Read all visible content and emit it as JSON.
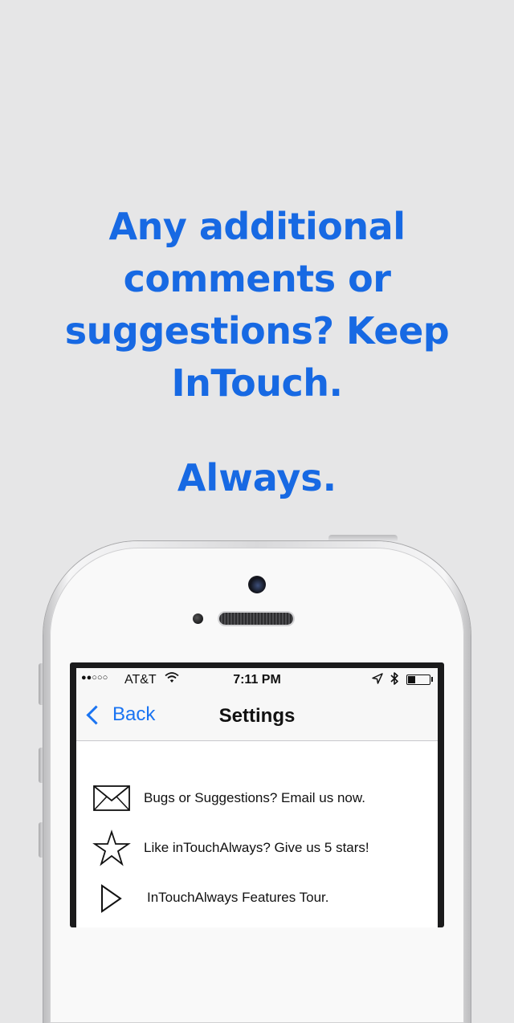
{
  "promo": {
    "headline_lines": [
      "Any additional",
      "comments or",
      "suggestions? Keep",
      "InTouch."
    ],
    "tagline": "Always.",
    "accent_color": "#1769e3"
  },
  "device": {
    "status_bar": {
      "signal": "●●○○○",
      "carrier": "AT&T",
      "wifi_icon": "wifi-icon",
      "time": "7:11 PM",
      "location_icon": "location-arrow-icon",
      "bluetooth_icon": "bluetooth-icon",
      "battery_level": 0.35
    },
    "nav": {
      "back_label": "Back",
      "title": "Settings",
      "tint_color": "#1a74f2"
    },
    "menu": [
      {
        "label": "Bugs or Suggestions? Email us now.",
        "icon": "envelope-icon"
      },
      {
        "label": "Like inTouchAlways? Give us 5 stars!",
        "icon": "star-icon"
      },
      {
        "label": "InTouchAlways Features Tour.",
        "icon": "play-icon"
      }
    ]
  }
}
